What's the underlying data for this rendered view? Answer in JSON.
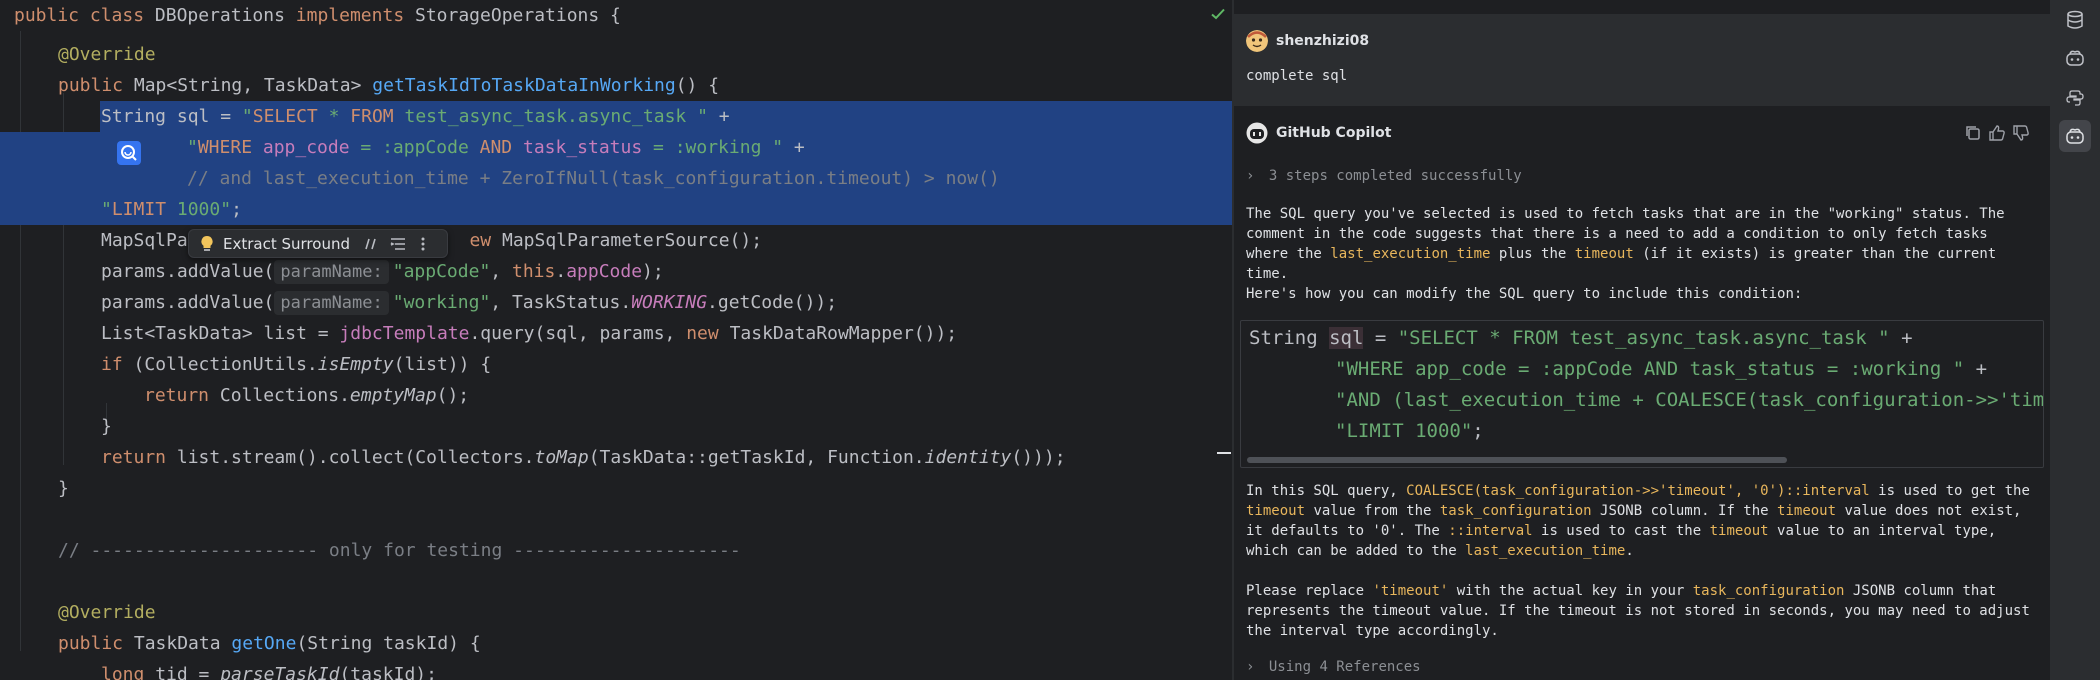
{
  "editor": {
    "lines": [
      [
        {
          "t": "public",
          "c": "kw"
        },
        {
          "t": " "
        },
        {
          "t": "class",
          "c": "kw"
        },
        {
          "t": " DBOperations "
        },
        {
          "t": "implements",
          "c": "kw"
        },
        {
          "t": " StorageOperations {"
        }
      ],
      [
        {
          "t": "@Override",
          "c": "ann"
        }
      ],
      [
        {
          "t": "public",
          "c": "kw"
        },
        {
          "t": " Map<String, TaskData> "
        },
        {
          "t": "getTaskIdToTaskDataInWorking",
          "c": "fn"
        },
        {
          "t": "() {"
        }
      ],
      [
        {
          "t": "String sql = "
        },
        {
          "t": "\"",
          "c": "str"
        },
        {
          "t": "SELECT",
          "c": "sqlkw"
        },
        {
          "t": " * ",
          "c": "str"
        },
        {
          "t": "FROM",
          "c": "sqlkw"
        },
        {
          "t": " test_async_task.async_task ",
          "c": "str"
        },
        {
          "t": "\"",
          "c": "str"
        },
        {
          "t": " +"
        }
      ],
      [
        {
          "t": "\"",
          "c": "str"
        },
        {
          "t": "WHERE",
          "c": "sqlkw"
        },
        {
          "t": " ",
          "c": "str"
        },
        {
          "t": "app_code",
          "c": "sqlid"
        },
        {
          "t": " = :appCode ",
          "c": "str"
        },
        {
          "t": "AND",
          "c": "sqlkw"
        },
        {
          "t": " ",
          "c": "str"
        },
        {
          "t": "task_status",
          "c": "sqlid"
        },
        {
          "t": " = :working \"",
          "c": "str"
        },
        {
          "t": " +"
        }
      ],
      [
        {
          "t": "// and last_execution_time + ZeroIfNull(task_configuration.timeout) > now()",
          "c": "com"
        }
      ],
      [
        {
          "t": "\"",
          "c": "str"
        },
        {
          "t": "LIMIT",
          "c": "sqlkw"
        },
        {
          "t": " 1000\"",
          "c": "str"
        },
        {
          "t": ";"
        }
      ],
      [
        {
          "t": "MapSqlPa"
        },
        {
          "t": "                          "
        },
        {
          "t": "ew",
          "c": "kw"
        },
        {
          "t": " MapSqlParameterSource();"
        }
      ],
      [
        {
          "t": "params.addValue("
        },
        {
          "t": "paramName:",
          "c": "hint"
        },
        {
          "t": "\"appCode\"",
          "c": "str"
        },
        {
          "t": ", "
        },
        {
          "t": "this",
          "c": "kw"
        },
        {
          "t": "."
        },
        {
          "t": "appCode",
          "c": "field"
        },
        {
          "t": ");"
        }
      ],
      [
        {
          "t": "params.addValue("
        },
        {
          "t": "paramName:",
          "c": "hint"
        },
        {
          "t": "\"working\"",
          "c": "str"
        },
        {
          "t": ", TaskStatus."
        },
        {
          "t": "WORKING",
          "c": "static"
        },
        {
          "t": ".getCode());"
        }
      ],
      [
        {
          "t": "List<TaskData> list = "
        },
        {
          "t": "jdbcTemplate",
          "c": "field"
        },
        {
          "t": ".query(sql, params, "
        },
        {
          "t": "new",
          "c": "kw"
        },
        {
          "t": " TaskDataRowMapper());"
        }
      ],
      [
        {
          "t": "if",
          "c": "kw"
        },
        {
          "t": " (CollectionUtils."
        },
        {
          "t": "isEmpty",
          "c": "it"
        },
        {
          "t": "(list)) {"
        }
      ],
      [
        {
          "t": "return",
          "c": "kw"
        },
        {
          "t": " Collections."
        },
        {
          "t": "emptyMap",
          "c": "it"
        },
        {
          "t": "();"
        }
      ],
      [
        {
          "t": "}"
        }
      ],
      [
        {
          "t": "return",
          "c": "kw"
        },
        {
          "t": " list.stream().collect(Collectors."
        },
        {
          "t": "toMap",
          "c": "it"
        },
        {
          "t": "(TaskData::getTaskId, Function."
        },
        {
          "t": "identity",
          "c": "it"
        },
        {
          "t": "()));"
        }
      ],
      [
        {
          "t": "}"
        }
      ],
      [],
      [
        {
          "t": "// --------------------- only for testing ---------------------",
          "c": "com"
        }
      ],
      [],
      [
        {
          "t": "@Override",
          "c": "ann"
        }
      ],
      [
        {
          "t": "public",
          "c": "kw"
        },
        {
          "t": " TaskData "
        },
        {
          "t": "getOne",
          "c": "fn"
        },
        {
          "t": "(String taskId) {"
        }
      ],
      [
        {
          "t": "long",
          "c": "kw"
        },
        {
          "t": " tid = "
        },
        {
          "t": "parseTaskId",
          "c": "it"
        },
        {
          "t": "(taskId);"
        }
      ]
    ],
    "intention_popup": {
      "label": "Extract Surround"
    }
  },
  "chat": {
    "user": {
      "name": "shenzhizi08",
      "message": "complete sql"
    },
    "assistant": {
      "name": "GitHub Copilot",
      "steps": "3 steps completed successfully",
      "para1": [
        {
          "t": "The SQL query you've selected is used to fetch tasks that are in the \"working\" status. The comment in the code suggests that there is a need to add a condition to only fetch tasks where the "
        },
        {
          "t": "last_execution_time",
          "hl": true
        },
        {
          "t": " plus the "
        },
        {
          "t": "timeout",
          "hl": true
        },
        {
          "t": " (if it exists) is greater than the current time."
        }
      ],
      "para2": "Here's how you can modify the SQL query to include this condition:",
      "code": [
        [
          {
            "t": "String "
          },
          {
            "t": "sql",
            "c": "sqlvar"
          },
          {
            "t": " = "
          },
          {
            "t": "\"SELECT * FROM test_async_task.async_task \"",
            "c": "str"
          },
          {
            "t": " +"
          }
        ],
        [
          {
            "t": "",
            "c": "indent"
          },
          {
            "t": "\"WHERE app_code = :appCode AND task_status = :working \"",
            "c": "str"
          },
          {
            "t": " +"
          }
        ],
        [
          {
            "t": "",
            "c": "indent"
          },
          {
            "t": "\"AND (last_execution_time + COALESCE(task_configuration->>'timeout'",
            "c": "str"
          }
        ],
        [
          {
            "t": "",
            "c": "indent"
          },
          {
            "t": "\"LIMIT 1000\"",
            "c": "str"
          },
          {
            "t": ";"
          }
        ]
      ],
      "para3": [
        {
          "t": "In this SQL query, "
        },
        {
          "t": "COALESCE(task_configuration->>'timeout', '0')::interval",
          "hl": true
        },
        {
          "t": " is used to get the "
        },
        {
          "t": "timeout",
          "hl": true
        },
        {
          "t": " value from the "
        },
        {
          "t": "task_configuration",
          "hl": true
        },
        {
          "t": " JSONB column. If the "
        },
        {
          "t": "timeout",
          "hl": true
        },
        {
          "t": " value does not exist, it defaults to '0'. The "
        },
        {
          "t": "::interval",
          "hl": true
        },
        {
          "t": " is used to cast the "
        },
        {
          "t": "timeout",
          "hl": true
        },
        {
          "t": " value to an interval type, which can be added to the "
        },
        {
          "t": "last_execution_time",
          "hl": true
        },
        {
          "t": "."
        }
      ],
      "para4": [
        {
          "t": "Please replace "
        },
        {
          "t": "'timeout'",
          "hl": true
        },
        {
          "t": " with the actual key in your "
        },
        {
          "t": "task_configuration",
          "hl": true
        },
        {
          "t": " JSONB column that represents the timeout value. If the timeout is not stored in seconds, you may need to adjust the interval type accordingly."
        }
      ],
      "references": "Using 4 References"
    }
  },
  "toolstrip": [
    "database-icon",
    "copilot-icon",
    "python-icon",
    "copilot-chat-icon"
  ],
  "colors": {
    "selection": "#214283",
    "accent": "#3574f0",
    "highlight": "#e8b65c"
  }
}
